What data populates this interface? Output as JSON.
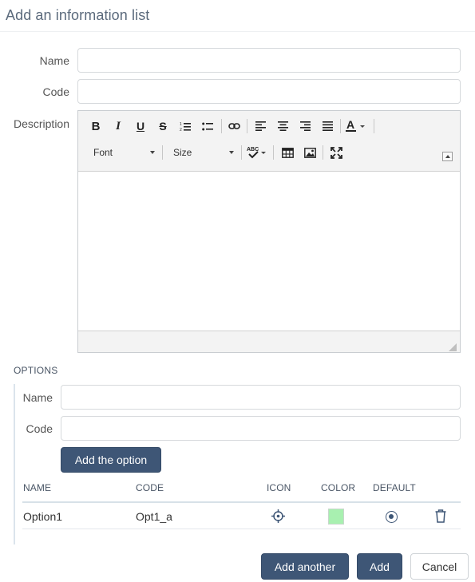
{
  "dialog": {
    "title": "Add an information list"
  },
  "form": {
    "name_label": "Name",
    "name_value": "",
    "code_label": "Code",
    "code_value": "",
    "description_label": "Description"
  },
  "editor": {
    "toolbar_icons": [
      "bold-icon",
      "italic-icon",
      "underline-icon",
      "strikethrough-icon",
      "numbered-list-icon",
      "bulleted-list-icon",
      "link-icon",
      "align-left-icon",
      "align-center-icon",
      "align-right-icon",
      "align-justify-icon",
      "text-color-icon",
      "spellcheck-icon",
      "table-icon",
      "image-icon",
      "maximize-icon"
    ],
    "font_label": "Font",
    "size_label": "Size",
    "spell_label": "ABC",
    "content": ""
  },
  "options": {
    "section_title": "OPTIONS",
    "name_label": "Name",
    "name_value": "",
    "code_label": "Code",
    "code_value": "",
    "add_option_label": "Add the option",
    "columns": [
      "NAME",
      "CODE",
      "ICON",
      "COLOR",
      "DEFAULT"
    ],
    "rows": [
      {
        "name": "Option1",
        "code": "Opt1_a",
        "icon": "crosshair-icon",
        "color": "#a8f0b0",
        "default": true
      }
    ]
  },
  "footer": {
    "add_another_label": "Add another",
    "add_label": "Add",
    "cancel_label": "Cancel"
  },
  "colors": {
    "primary": "#3e5676",
    "header_text": "#5b6a7c",
    "table_rule": "#d7e1e8"
  }
}
